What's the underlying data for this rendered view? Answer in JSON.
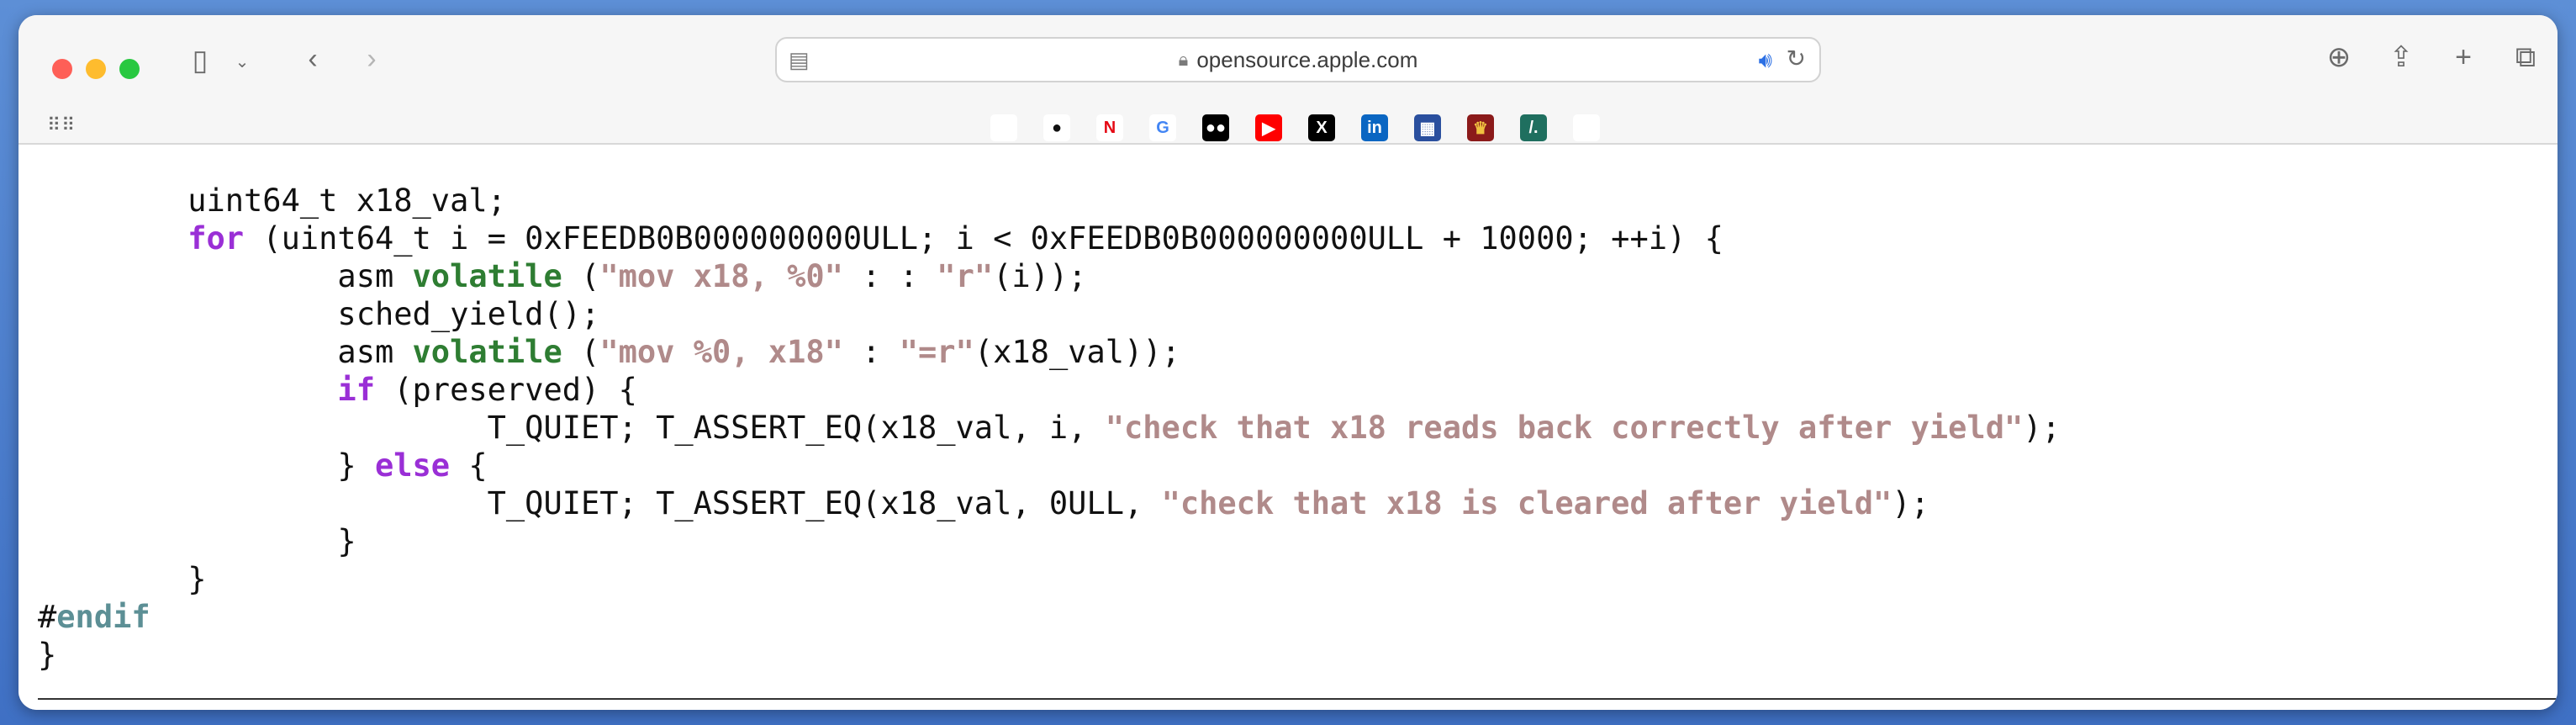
{
  "browser": {
    "url": "opensource.apple.com",
    "favorites": [
      {
        "name": "apple",
        "glyph": "",
        "bg": "#ffffff",
        "fg": "#222222"
      },
      {
        "name": "github",
        "glyph": "●",
        "bg": "#ffffff",
        "fg": "#111111"
      },
      {
        "name": "netflix",
        "glyph": "N",
        "bg": "#ffffff",
        "fg": "#e50914"
      },
      {
        "name": "google",
        "glyph": "G",
        "bg": "#ffffff",
        "fg": "#4285f4"
      },
      {
        "name": "medium",
        "glyph": "●●",
        "bg": "#000000",
        "fg": "#ffffff"
      },
      {
        "name": "youtube",
        "glyph": "▶",
        "bg": "#ff0000",
        "fg": "#ffffff"
      },
      {
        "name": "x",
        "glyph": "X",
        "bg": "#000000",
        "fg": "#ffffff"
      },
      {
        "name": "linkedin",
        "glyph": "in",
        "bg": "#0a66c2",
        "fg": "#ffffff"
      },
      {
        "name": "site",
        "glyph": "▦",
        "bg": "#2a4f9e",
        "fg": "#ffffff"
      },
      {
        "name": "shield",
        "glyph": "♛",
        "bg": "#8b1a1a",
        "fg": "#f0c040"
      },
      {
        "name": "slash",
        "glyph": "/.",
        "bg": "#1f6f5f",
        "fg": "#ffffff"
      },
      {
        "name": "apple-2",
        "glyph": "",
        "bg": "#ffffff",
        "fg": "#222222"
      }
    ]
  },
  "code": {
    "lines": [
      [
        {
          "t": "        uint64_t x18_val;",
          "c": ""
        }
      ],
      [
        {
          "t": "        ",
          "c": ""
        },
        {
          "t": "for",
          "c": "kw"
        },
        {
          "t": " (uint64_t i = 0xFEEDB0B000000000ULL; i < 0xFEEDB0B000000000ULL + 10000; ++i) {",
          "c": ""
        }
      ],
      [
        {
          "t": "                asm ",
          "c": ""
        },
        {
          "t": "volatile",
          "c": "kv"
        },
        {
          "t": " (",
          "c": ""
        },
        {
          "t": "\"mov x18, %0\"",
          "c": "str"
        },
        {
          "t": " : : ",
          "c": ""
        },
        {
          "t": "\"r\"",
          "c": "str"
        },
        {
          "t": "(i));",
          "c": ""
        }
      ],
      [
        {
          "t": "                sched_yield();",
          "c": ""
        }
      ],
      [
        {
          "t": "                asm ",
          "c": ""
        },
        {
          "t": "volatile",
          "c": "kv"
        },
        {
          "t": " (",
          "c": ""
        },
        {
          "t": "\"mov %0, x18\"",
          "c": "str"
        },
        {
          "t": " : ",
          "c": ""
        },
        {
          "t": "\"=r\"",
          "c": "str"
        },
        {
          "t": "(x18_val));",
          "c": ""
        }
      ],
      [
        {
          "t": "                ",
          "c": ""
        },
        {
          "t": "if",
          "c": "kw"
        },
        {
          "t": " (preserved) {",
          "c": ""
        }
      ],
      [
        {
          "t": "                        T_QUIET; T_ASSERT_EQ(x18_val, i, ",
          "c": ""
        },
        {
          "t": "\"check that x18 reads back correctly after yield\"",
          "c": "str"
        },
        {
          "t": ");",
          "c": ""
        }
      ],
      [
        {
          "t": "                } ",
          "c": ""
        },
        {
          "t": "else",
          "c": "kw"
        },
        {
          "t": " {",
          "c": ""
        }
      ],
      [
        {
          "t": "                        T_QUIET; T_ASSERT_EQ(x18_val, 0ULL, ",
          "c": ""
        },
        {
          "t": "\"check that x18 is cleared after yield\"",
          "c": "str"
        },
        {
          "t": ");",
          "c": ""
        }
      ],
      [
        {
          "t": "                }",
          "c": ""
        }
      ],
      [
        {
          "t": "        }",
          "c": ""
        }
      ],
      [
        {
          "t": "#",
          "c": ""
        },
        {
          "t": "endif",
          "c": "pp"
        }
      ],
      [
        {
          "t": "}",
          "c": ""
        }
      ]
    ]
  }
}
